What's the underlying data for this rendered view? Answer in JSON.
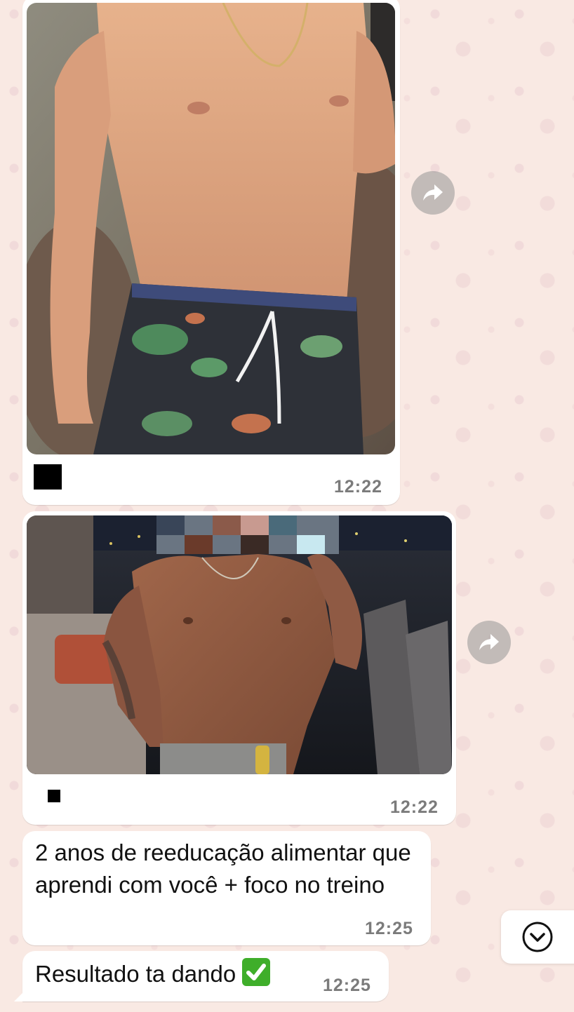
{
  "messages": [
    {
      "type": "photo",
      "time": "12:22"
    },
    {
      "type": "photo",
      "time": "12:22"
    },
    {
      "type": "text",
      "text": "2 anos de reeducação alimentar que aprendi com você + foco no treino",
      "time": "12:25"
    },
    {
      "type": "text",
      "text": "Resultado ta dando",
      "emoji": "check-mark-button",
      "time": "12:25"
    }
  ],
  "icons": {
    "forward": "forward-arrow-icon",
    "scroll_down": "chevron-down-icon"
  },
  "colors": {
    "wallpaper": "#f9e9e3",
    "bubble": "#ffffff",
    "timestamp": "#7b7b7b",
    "check_emoji": "#3fae2a"
  }
}
